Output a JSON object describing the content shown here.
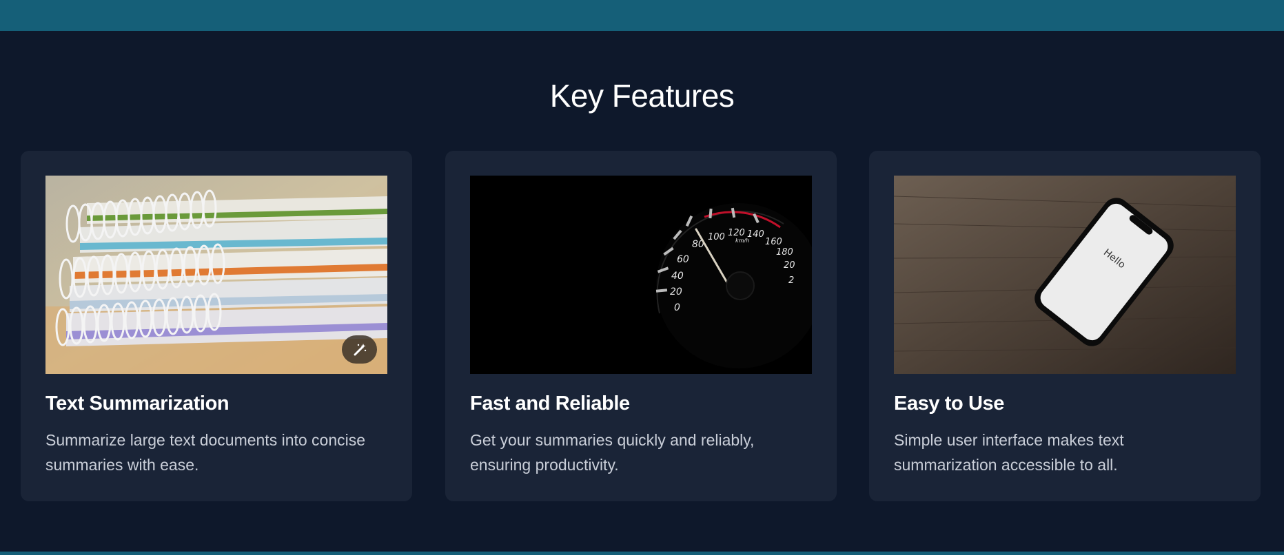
{
  "section": {
    "title": "Key Features"
  },
  "features": [
    {
      "title": "Text Summarization",
      "description": "Summarize large text documents into concise summaries with ease.",
      "image_icon": "notebooks-stack-photo"
    },
    {
      "title": "Fast and Reliable",
      "description": "Get your summaries quickly and reliably, ensuring productivity.",
      "image_icon": "speedometer-photo",
      "speedometer_labels": [
        "0",
        "20",
        "40",
        "60",
        "80",
        "100",
        "120",
        "140",
        "160",
        "180",
        "20",
        "2"
      ],
      "speedometer_unit": "km/h"
    },
    {
      "title": "Easy to Use",
      "description": "Simple user interface makes text summarization accessible to all.",
      "image_icon": "smartphone-photo",
      "phone_screen_text": "Hello"
    }
  ],
  "image_action": {
    "icon": "magic-wand-icon"
  },
  "colors": {
    "background": "#0e182b",
    "card": "#1a2437",
    "accent_bar": "#155f78",
    "title_text": "#ffffff",
    "body_text": "#c9ced8"
  }
}
